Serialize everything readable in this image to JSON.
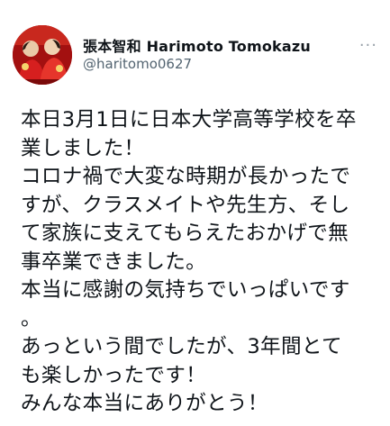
{
  "tweet": {
    "author": {
      "display_name": "張本智和 Harimoto Tomokazu",
      "handle": "@haritomo0627"
    },
    "more_label": "···",
    "lines": [
      "本日3月1日に日本大学高等学校を卒",
      "業しました！",
      "コロナ禍で大変な時期が長かったで",
      "すが、クラスメイトや先生方、そし",
      "て家族に支えてもらえたおかげで無",
      "事卒業できました。",
      "本当に感謝の気持ちでいっぱいです",
      "。",
      "あっという間でしたが、3年間とて",
      "も楽しかったです！",
      "みんな本当にありがとう！"
    ]
  },
  "colors": {
    "text": "#0f1419",
    "secondary": "#536471",
    "avatar_bg": "#b31212"
  }
}
